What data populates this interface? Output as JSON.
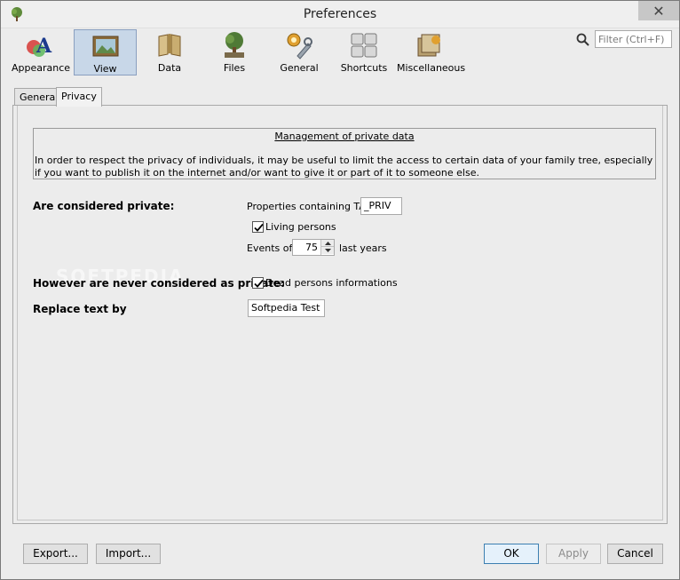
{
  "window": {
    "title": "Preferences",
    "close_label": "✕"
  },
  "toolbar": {
    "items": [
      {
        "label": "Appearance",
        "icon": "appearance-icon"
      },
      {
        "label": "View",
        "icon": "view-icon",
        "selected": true
      },
      {
        "label": "Data",
        "icon": "data-icon"
      },
      {
        "label": "Files",
        "icon": "files-icon"
      },
      {
        "label": "General",
        "icon": "general-icon"
      },
      {
        "label": "Shortcuts",
        "icon": "shortcuts-icon"
      },
      {
        "label": "Miscellaneous",
        "icon": "miscellaneous-icon"
      }
    ],
    "search_placeholder": "Filter (Ctrl+F)"
  },
  "tabs": [
    {
      "label": "General"
    },
    {
      "label": "Privacy",
      "active": true
    }
  ],
  "privacy": {
    "info_title": "Management of private data",
    "info_text": "In order to respect the privacy of individuals, it may be useful to limit the access to certain data of your family tree, especially if you want to publish it on the internet and/or want to give it or part of it to someone else.",
    "considered_private_label": "Are considered private:",
    "tag_label": "Properties containing TAG",
    "tag_value": "_PRIV",
    "living_label": "Living persons",
    "living_checked": true,
    "events_label": "Events of",
    "events_value": "75",
    "last_years_label": "last years",
    "never_private_label": "However are never considered as private:",
    "dead_label": "Dead persons informations",
    "dead_checked": true,
    "replace_label": "Replace text by",
    "replace_value": "Softpedia Test"
  },
  "watermark": "SOFTPEDIA",
  "buttons": {
    "export": "Export...",
    "import": "Import...",
    "ok": "OK",
    "apply": "Apply",
    "cancel": "Cancel"
  },
  "colors": {
    "selected_tool_bg": "#c8d7e8",
    "default_button_border": "#3c7fb1"
  }
}
